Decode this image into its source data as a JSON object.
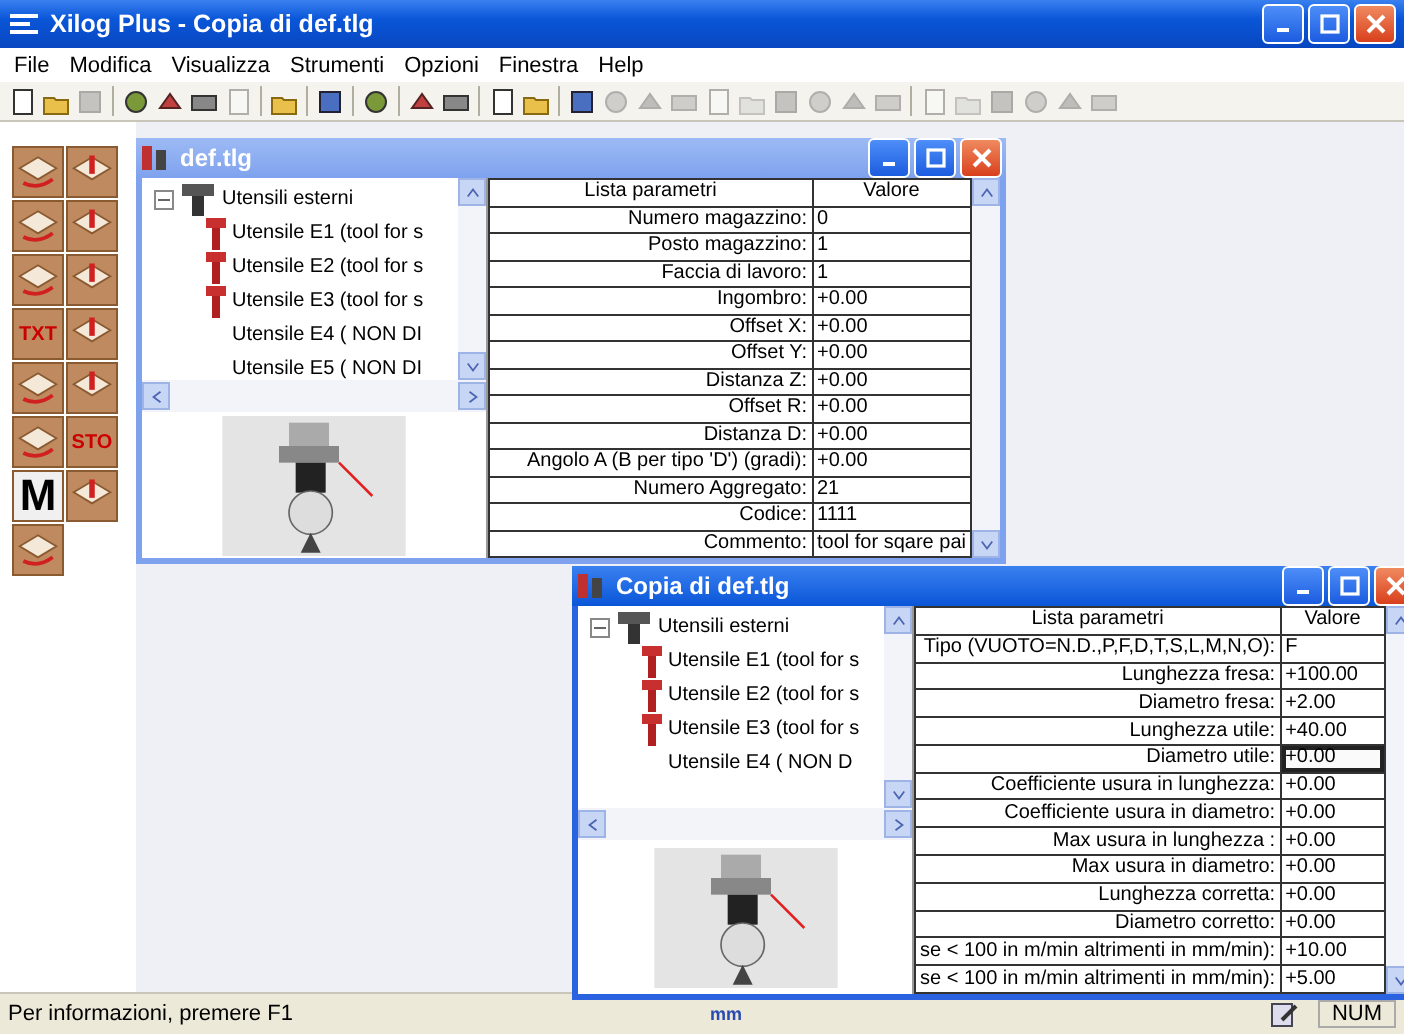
{
  "window": {
    "title": "Xilog Plus - Copia di def.tlg"
  },
  "menu": [
    "File",
    "Modifica",
    "Visualizza",
    "Strumenti",
    "Opzioni",
    "Finestra",
    "Help"
  ],
  "toolbar": [
    {
      "kind": "button",
      "disabled": false
    },
    {
      "kind": "button",
      "disabled": false
    },
    {
      "kind": "button",
      "disabled": true
    },
    {
      "kind": "separator"
    },
    {
      "kind": "button",
      "disabled": false
    },
    {
      "kind": "button",
      "disabled": false
    },
    {
      "kind": "button",
      "disabled": false
    },
    {
      "kind": "button",
      "disabled": true
    },
    {
      "kind": "separator"
    },
    {
      "kind": "button",
      "disabled": false
    },
    {
      "kind": "separator"
    },
    {
      "kind": "button",
      "disabled": false
    },
    {
      "kind": "separator"
    },
    {
      "kind": "button",
      "disabled": false
    },
    {
      "kind": "separator"
    },
    {
      "kind": "button",
      "disabled": false
    },
    {
      "kind": "button",
      "disabled": false
    },
    {
      "kind": "separator"
    },
    {
      "kind": "button",
      "disabled": false
    },
    {
      "kind": "button",
      "disabled": false
    },
    {
      "kind": "separator"
    },
    {
      "kind": "button",
      "disabled": false
    },
    {
      "kind": "button",
      "disabled": true
    },
    {
      "kind": "button",
      "disabled": true
    },
    {
      "kind": "button",
      "disabled": true
    },
    {
      "kind": "button",
      "disabled": true
    },
    {
      "kind": "button",
      "disabled": true
    },
    {
      "kind": "button",
      "disabled": true
    },
    {
      "kind": "button",
      "disabled": true
    },
    {
      "kind": "button",
      "disabled": true
    },
    {
      "kind": "button",
      "disabled": true
    },
    {
      "kind": "separator"
    },
    {
      "kind": "button",
      "disabled": true
    },
    {
      "kind": "button",
      "disabled": true
    },
    {
      "kind": "button",
      "disabled": true
    },
    {
      "kind": "button",
      "disabled": true
    },
    {
      "kind": "button",
      "disabled": true
    },
    {
      "kind": "button",
      "disabled": true
    }
  ],
  "palette": [
    {
      "kind": "tool"
    },
    {
      "kind": "tool"
    },
    {
      "kind": "tool"
    },
    {
      "kind": "tool"
    },
    {
      "kind": "tool"
    },
    {
      "kind": "tool"
    },
    {
      "kind": "text",
      "label": "TXT"
    },
    {
      "kind": "tool"
    },
    {
      "kind": "tool"
    },
    {
      "kind": "tool"
    },
    {
      "kind": "tool"
    },
    {
      "kind": "text",
      "label": "STO"
    },
    {
      "kind": "text",
      "label": "M"
    },
    {
      "kind": "tool"
    },
    {
      "kind": "tool"
    }
  ],
  "documents": [
    {
      "title": "def.tlg",
      "active": false,
      "tree": {
        "label": "Utensili esterni",
        "expanded": true,
        "children": [
          {
            "label": "Utensile E1 (tool for s",
            "has_icon": true
          },
          {
            "label": "Utensile E2 (tool for s",
            "has_icon": true
          },
          {
            "label": "Utensile E3 (tool for s",
            "has_icon": true
          },
          {
            "label": "Utensile E4 ( NON DI",
            "has_icon": false
          },
          {
            "label": "Utensile E5 ( NON DI",
            "has_icon": false
          }
        ]
      },
      "table": {
        "columns": [
          "Lista parametri",
          "Valore"
        ],
        "rows": [
          {
            "label": "Numero magazzino:",
            "value": "0",
            "selected": false
          },
          {
            "label": "Posto magazzino:",
            "value": "1",
            "selected": false
          },
          {
            "label": "Faccia di lavoro:",
            "value": "1",
            "selected": false
          },
          {
            "label": "Ingombro:",
            "value": "+0.00",
            "selected": false
          },
          {
            "label": "Offset X:",
            "value": "+0.00",
            "selected": false
          },
          {
            "label": "Offset Y:",
            "value": "+0.00",
            "selected": false
          },
          {
            "label": "Distanza Z:",
            "value": "+0.00",
            "selected": false
          },
          {
            "label": "Offset R:",
            "value": "+0.00",
            "selected": false
          },
          {
            "label": "Distanza D:",
            "value": "+0.00",
            "selected": false
          },
          {
            "label": "Angolo A (B per tipo 'D') (gradi):",
            "value": "+0.00",
            "selected": false
          },
          {
            "label": "Numero Aggregato:",
            "value": "21",
            "selected": false
          },
          {
            "label": "Codice:",
            "value": "1111",
            "selected": false
          },
          {
            "label": "Commento:",
            "value": "tool for sqare pai",
            "selected": false
          }
        ]
      }
    },
    {
      "title": "Copia di def.tlg",
      "active": true,
      "tree": {
        "label": "Utensili esterni",
        "expanded": true,
        "children": [
          {
            "label": "Utensile E1 (tool for s",
            "has_icon": true
          },
          {
            "label": "Utensile E2 (tool for s",
            "has_icon": true
          },
          {
            "label": "Utensile E3 (tool for s",
            "has_icon": true
          },
          {
            "label": "Utensile E4 ( NON D",
            "has_icon": false
          }
        ]
      },
      "table": {
        "columns": [
          "Lista parametri",
          "Valore"
        ],
        "rows": [
          {
            "label": "Tipo (VUOTO=N.D.,P,F,D,T,S,L,M,N,O):",
            "value": "F",
            "selected": false
          },
          {
            "label": "Lunghezza fresa:",
            "value": "+100.00",
            "selected": false
          },
          {
            "label": "Diametro fresa:",
            "value": "+2.00",
            "selected": false
          },
          {
            "label": "Lunghezza utile:",
            "value": "+40.00",
            "selected": false
          },
          {
            "label": "Diametro utile:",
            "value": "+0.00",
            "selected": true
          },
          {
            "label": "Coefficiente usura in lunghezza:",
            "value": "+0.00",
            "selected": false
          },
          {
            "label": "Coefficiente usura in diametro:",
            "value": "+0.00",
            "selected": false
          },
          {
            "label": "Max usura in lunghezza :",
            "value": "+0.00",
            "selected": false
          },
          {
            "label": "Max usura in diametro:",
            "value": "+0.00",
            "selected": false
          },
          {
            "label": "Lunghezza corretta:",
            "value": "+0.00",
            "selected": false
          },
          {
            "label": "Diametro corretto:",
            "value": "+0.00",
            "selected": false
          },
          {
            "label": "se < 100 in m/min altrimenti in mm/min):",
            "value": "+10.00",
            "selected": false
          },
          {
            "label": "se < 100 in m/min altrimenti in mm/min):",
            "value": "+5.00",
            "selected": false
          }
        ]
      }
    }
  ],
  "status_bar": {
    "text": "Per informazioni, premere F1",
    "units": "mm",
    "indicators": [
      "NUM"
    ]
  }
}
